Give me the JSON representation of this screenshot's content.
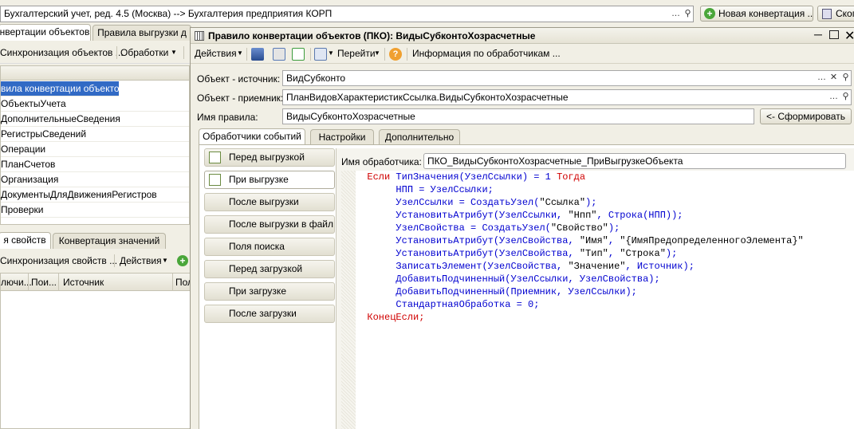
{
  "topbar": {
    "path": "Бухгалтерский учет, ред. 4.5 (Москва) --> Бухгалтерия предприятия КОРП",
    "new_conversion": "Новая конвертация ...",
    "copy_btn": "Скоп"
  },
  "left": {
    "tabs": [
      "нвертации объектов",
      "Правила выгрузки д"
    ],
    "toolbar": {
      "sync": "Синхронизация объектов ...",
      "handlers": "Обработки"
    },
    "tree": [
      "вила конвертации объектов",
      "ОбъектыУчета",
      "ДополнительныеСведения",
      "РегистрыСведений",
      "Операции",
      "ПланСчетов",
      "Организация",
      "ДокументыДляДвиженияРегистров",
      "Проверки"
    ],
    "bottom_tabs": [
      "я свойств",
      "Конвертация значений"
    ],
    "bottom_toolbar": {
      "sync": "Синхронизация свойств ...",
      "actions": "Действия"
    },
    "columns": [
      "лючи...",
      "Пои...",
      "Источник",
      "Пол"
    ]
  },
  "dialog": {
    "title": "Правило конвертации объектов (ПКО): ВидыСубконтоХозрасчетные",
    "toolbar": {
      "actions": "Действия",
      "goto": "Перейти",
      "info": "Информация по обработчикам ..."
    },
    "source_label": "Объект - источник:",
    "source_value": "ВидСубконто",
    "dest_label": "Объект - приемник:",
    "dest_value": "ПланВидовХарактеристикСсылка.ВидыСубконтоХозрасчетные",
    "name_label": "Имя правила:",
    "name_value": "ВидыСубконтоХозрасчетные",
    "form_btn": "<- Сформировать",
    "tabs": [
      "Обработчики событий",
      "Настройки",
      "Дополнительно"
    ],
    "events": [
      "Перед выгрузкой",
      "При выгрузке",
      "После выгрузки",
      "После выгрузки в файл",
      "Поля поиска",
      "Перед загрузкой",
      "При загрузке",
      "После загрузки"
    ],
    "handler_label": "Имя обработчика:",
    "handler_value": "ПКО_ВидыСубконтоХозрасчетные_ПриВыгрузкеОбъекта",
    "code": {
      "l1_kw1": "Если ",
      "l1_id": "ТипЗначения",
      "l1_a": "(",
      "l1_id2": "УзелСсылки",
      "l1_b": ") = 1 ",
      "l1_kw2": "Тогда",
      "l2": "НПП = УзелСсылки;",
      "l3_id": "УзелСсылки = СоздатьУзел(",
      "l3_s": "\"Ссылка\"",
      "l3_e": ");",
      "l4_id": "УстановитьАтрибут(УзелСсылки, ",
      "l4_s": "\"Нпп\"",
      "l4_m": ", Строка(НПП));",
      "l5_id": "УзелСвойства = СоздатьУзел(",
      "l5_s": "\"Свойство\"",
      "l5_e": ");",
      "l6_id": "УстановитьАтрибут(УзелСвойства, ",
      "l6_s": "\"Имя\"",
      "l6_m": ", ",
      "l6_s2": "\"{ИмяПредопределенногоЭлемента}\"",
      "l7_id": "УстановитьАтрибут(УзелСвойства, ",
      "l7_s": "\"Тип\"",
      "l7_m": ", ",
      "l7_s2": "\"Строка\"",
      "l7_e": ");",
      "l8_id": "ЗаписатьЭлемент(УзелСвойства, ",
      "l8_s": "\"Значение\"",
      "l8_m": ", Источник);",
      "l9": "ДобавитьПодчиненный(УзелСсылки, УзелСвойства);",
      "l10": "ДобавитьПодчиненный(Приемник, УзелСсылки);",
      "l11_id": "СтандартнаяОбработка = 0;",
      "l12_kw": "КонецЕсли;"
    }
  }
}
